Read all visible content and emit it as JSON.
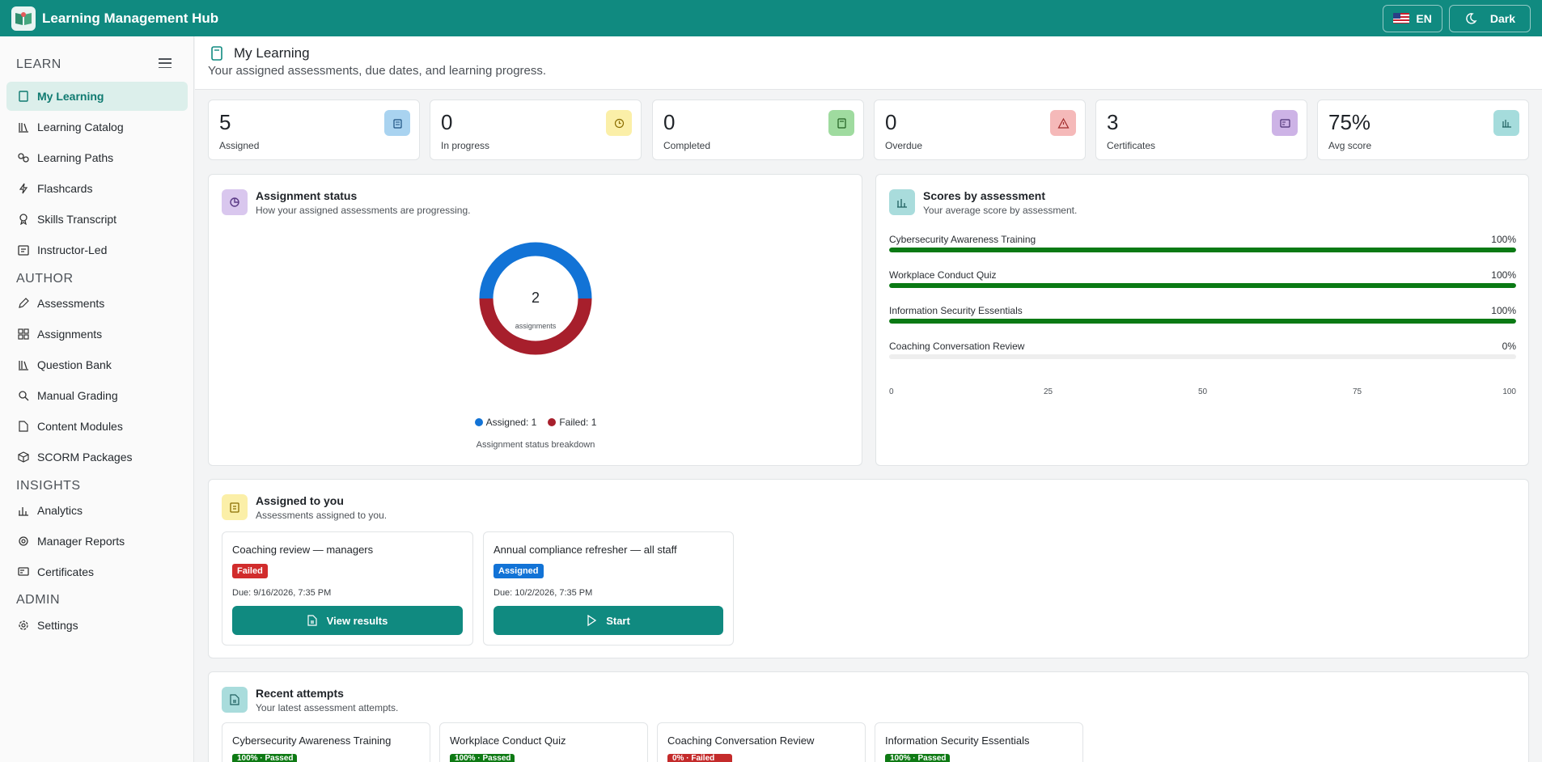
{
  "app": {
    "title": "Learning Management Hub",
    "lang_label": "EN",
    "theme_label": "Dark"
  },
  "sidebar": {
    "sections": [
      "LEARN",
      "AUTHOR",
      "INSIGHTS",
      "ADMIN"
    ],
    "learn": [
      "My Learning",
      "Learning Catalog",
      "Learning Paths",
      "Flashcards",
      "Skills Transcript",
      "Instructor-Led"
    ],
    "author": [
      "Assessments",
      "Assignments",
      "Question Bank",
      "Manual Grading",
      "Content Modules",
      "SCORM Packages"
    ],
    "insights": [
      "Analytics",
      "Manager Reports",
      "Certificates"
    ],
    "admin": [
      "Settings"
    ]
  },
  "page": {
    "title": "My Learning",
    "subtitle": "Your assigned assessments, due dates, and learning progress."
  },
  "stats": [
    {
      "value": "5",
      "label": "Assigned",
      "color": "#a9d3f0",
      "icon": "clipboard-icon"
    },
    {
      "value": "0",
      "label": "In progress",
      "color": "#fbefa8",
      "icon": "clock-icon"
    },
    {
      "value": "0",
      "label": "Completed",
      "color": "#9fdb9f",
      "icon": "check-doc-icon"
    },
    {
      "value": "0",
      "label": "Overdue",
      "color": "#f5b9b9",
      "icon": "warning-icon"
    },
    {
      "value": "3",
      "label": "Certificates",
      "color": "#cdb3e6",
      "icon": "certificate-icon"
    },
    {
      "value": "75%",
      "label": "Avg score",
      "color": "#a5dcdc",
      "icon": "chart-icon"
    }
  ],
  "assignment_status": {
    "title": "Assignment status",
    "subtitle": "How your assigned assessments are progressing.",
    "center_value": "2",
    "center_label": "assignments",
    "legend": [
      "Assigned: 1",
      "Failed: 1"
    ],
    "caption": "Assignment status breakdown",
    "colors": [
      "#1273d6",
      "#a71f2c"
    ]
  },
  "scores": {
    "title": "Scores by assessment",
    "subtitle": "Your average score by assessment.",
    "ticks": [
      "0",
      "25",
      "50",
      "75",
      "100"
    ]
  },
  "chart_data": [
    {
      "type": "pie",
      "categories": [
        "Assigned",
        "Failed"
      ],
      "values": [
        1,
        1
      ],
      "title": "Assignment status"
    },
    {
      "type": "bar",
      "categories": [
        "Cybersecurity Awareness Training",
        "Workplace Conduct Quiz",
        "Information Security Essentials",
        "Coaching Conversation Review"
      ],
      "values": [
        100,
        100,
        100,
        0
      ],
      "labels": [
        "100%",
        "100%",
        "100%",
        "0%"
      ],
      "title": "Scores by assessment",
      "xlim": [
        0,
        100
      ]
    }
  ],
  "assigned": {
    "title": "Assigned to you",
    "subtitle": "Assessments assigned to you.",
    "items": [
      {
        "title": "Coaching review — managers",
        "status": "Failed",
        "status_color": "#d12c2c",
        "due": "Due: 9/16/2026, 7:35 PM",
        "action": "View results"
      },
      {
        "title": "Annual compliance refresher — all staff",
        "status": "Assigned",
        "status_color": "#1273d6",
        "due": "Due: 10/2/2026, 7:35 PM",
        "action": "Start"
      }
    ]
  },
  "recent": {
    "title": "Recent attempts",
    "subtitle": "Your latest assessment attempts.",
    "items": [
      {
        "title": "Cybersecurity Awareness Training",
        "badge": "100% · Passed",
        "color": "#0e7a14"
      },
      {
        "title": "Workplace Conduct Quiz",
        "badge": "100% · Passed",
        "color": "#0e7a14"
      },
      {
        "title": "Coaching Conversation Review",
        "badge": "0% · Failed",
        "color": "#c42b2b"
      },
      {
        "title": "Information Security Essentials",
        "badge": "100% · Passed",
        "color": "#0e7a14"
      }
    ]
  }
}
